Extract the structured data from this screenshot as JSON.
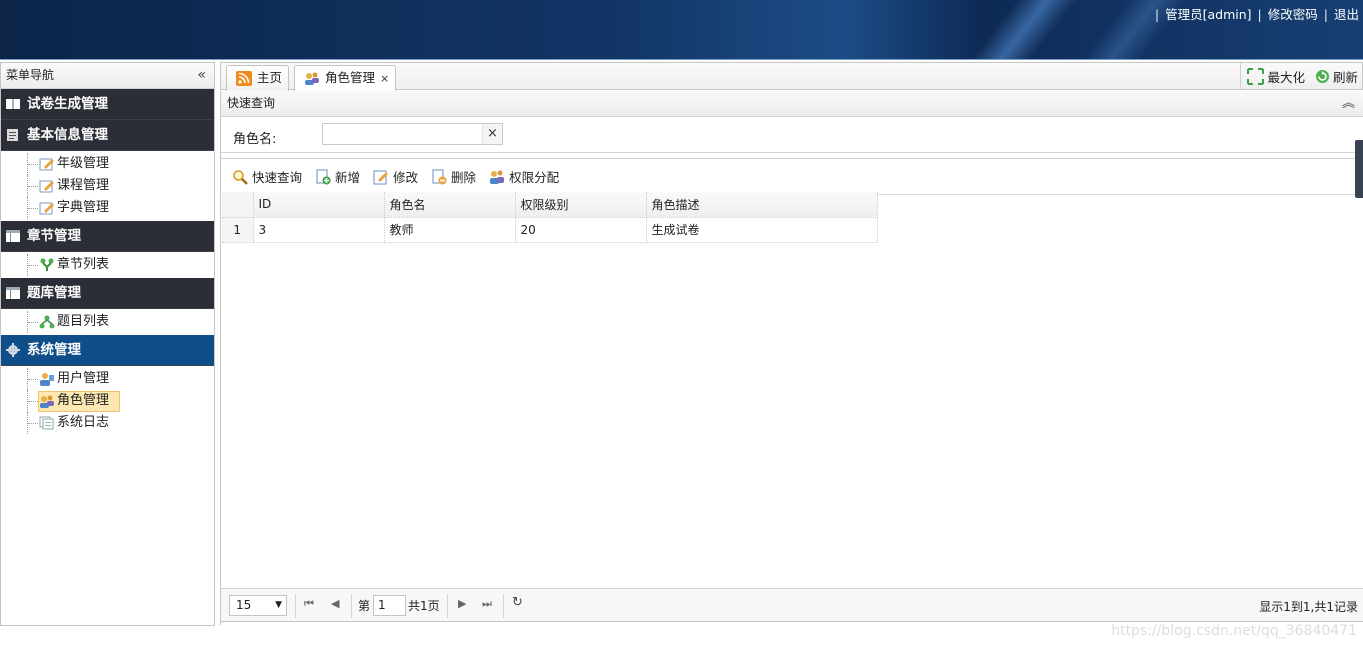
{
  "header": {
    "user_link": "管理员[admin]",
    "change_password": "修改密码",
    "logout": "退出"
  },
  "sidebar": {
    "title": "菜单导航",
    "groups": [
      {
        "label": "试卷生成管理",
        "items": []
      },
      {
        "label": "基本信息管理",
        "items": [
          {
            "label": "年级管理"
          },
          {
            "label": "课程管理"
          },
          {
            "label": "字典管理"
          }
        ]
      },
      {
        "label": "章节管理",
        "items": [
          {
            "label": "章节列表"
          }
        ]
      },
      {
        "label": "题库管理",
        "items": [
          {
            "label": "题目列表"
          }
        ]
      },
      {
        "label": "系统管理",
        "items": [
          {
            "label": "用户管理"
          },
          {
            "label": "角色管理"
          },
          {
            "label": "系统日志"
          }
        ]
      }
    ]
  },
  "tabs": {
    "home": "主页",
    "current": "角色管理",
    "close": "×",
    "maximize": "最大化",
    "refresh": "刷新"
  },
  "query": {
    "title": "快速查询",
    "role_name_label": "角色名:",
    "role_name_value": "",
    "clear": "×"
  },
  "toolbar": {
    "search": "快速查询",
    "add": "新增",
    "edit": "修改",
    "delete": "删除",
    "assign": "权限分配"
  },
  "grid": {
    "columns": [
      "ID",
      "角色名",
      "权限级别",
      "角色描述"
    ],
    "rows": [
      {
        "num": "1",
        "cells": [
          "3",
          "教师",
          "20",
          "生成试卷"
        ]
      }
    ]
  },
  "pager": {
    "page_size": "15",
    "page_prefix": "第",
    "page_value": "1",
    "total_pages": "共1页",
    "info": "显示1到1,共1记录"
  },
  "watermark": "https://blog.csdn.net/qq_36840471",
  "colors": {
    "header_bg": "#123566",
    "sidebar_group": "#2b2e36",
    "sidebar_active": "#0f4e89",
    "selected_item": "#fde8b4"
  }
}
